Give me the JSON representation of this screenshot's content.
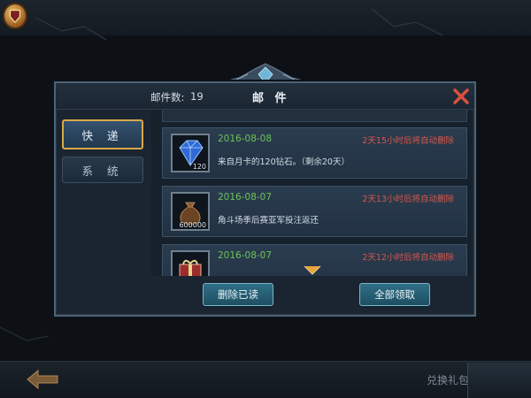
{
  "header": {
    "mail_count_label": "邮件数:",
    "mail_count_value": "19",
    "title": "邮 件"
  },
  "tabs": [
    {
      "label": "快 递",
      "active": true
    },
    {
      "label": "系 统",
      "active": false
    }
  ],
  "mails": [
    {
      "date": "2016-08-08",
      "expire": "2天15小时后将自动删除",
      "subject": "来自月卡的120钻石。（剩余20天）",
      "thumb_icon": "diamond-icon",
      "qty": "120"
    },
    {
      "date": "2016-08-07",
      "expire": "2天13小时后将自动删除",
      "subject": "角斗场季后赛亚军投注返还",
      "thumb_icon": "money-bag-icon",
      "qty": "600000"
    },
    {
      "date": "2016-08-07",
      "expire": "2天12小时后将自动删除",
      "subject": "",
      "thumb_icon": "gift-box-icon",
      "qty": ""
    }
  ],
  "actions": {
    "delete_read": "删除已读",
    "claim_all": "全部领取"
  },
  "bottom": {
    "redeem": "兑换礼包"
  },
  "colors": {
    "date_green": "#6bc456",
    "expire_red": "#d9574b",
    "tab_active_border": "#d8a84a",
    "button_teal": "#2f6f86"
  }
}
